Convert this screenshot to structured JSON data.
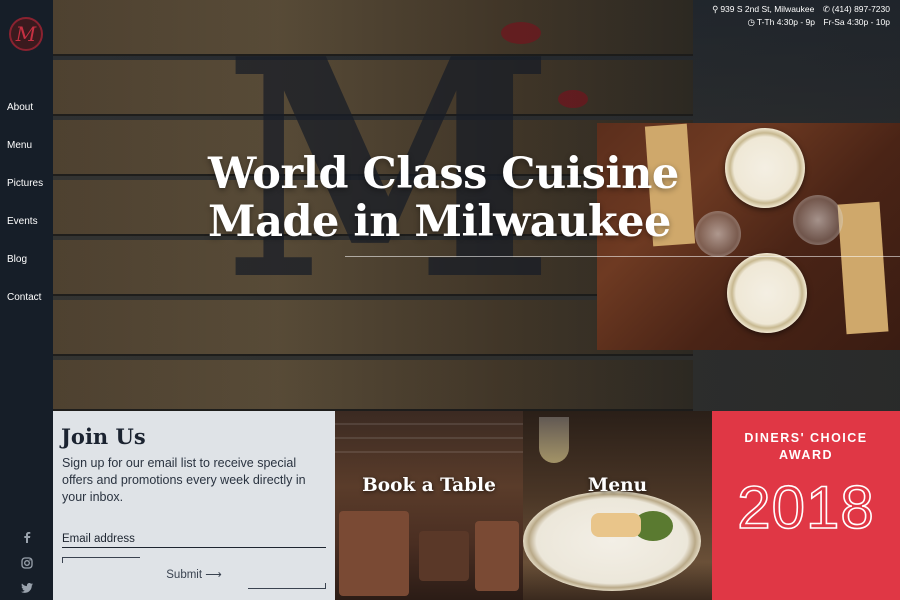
{
  "brand": {
    "logo_letter": "M"
  },
  "nav": {
    "items": [
      {
        "label": "About"
      },
      {
        "label": "Menu"
      },
      {
        "label": "Pictures"
      },
      {
        "label": "Events"
      },
      {
        "label": "Blog"
      },
      {
        "label": "Contact"
      }
    ]
  },
  "social": {
    "facebook": "f",
    "instagram": "◎",
    "twitter": "t"
  },
  "topbar": {
    "address": "939 S 2nd St, Milwaukee",
    "phone": "(414) 897-7230",
    "hours_weekday": "T-Th 4:30p - 9p",
    "hours_weekend": "Fr-Sa 4:30p - 10p"
  },
  "hero": {
    "title_line1": "World Class Cuisine",
    "title_line2": "Made in Milwaukee"
  },
  "join": {
    "title": "Join Us",
    "text": "Sign up for our email list to receive special offers and promotions every week directly in your inbox.",
    "email_placeholder": "Email address",
    "submit_label": "Submit ⟶"
  },
  "panels": {
    "book": "Book a Table",
    "menu": "Menu"
  },
  "award": {
    "label_line1": "DINERS' CHOICE",
    "label_line2": "AWARD",
    "year": "2018"
  },
  "colors": {
    "sidebar": "#161e28",
    "join_bg": "#dfe3e7",
    "award_red": "#e03745"
  }
}
